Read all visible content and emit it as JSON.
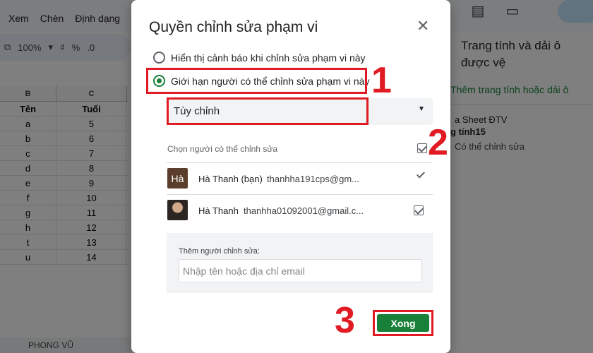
{
  "background": {
    "menu": [
      "Xem",
      "Chèn",
      "Định dạng"
    ],
    "toolbar": {
      "zoom": "100%",
      "currency": "₫",
      "percent": "%",
      "decimal": ".0"
    },
    "columns": [
      "B",
      "C"
    ],
    "table": {
      "headers": [
        "Tên",
        "Tuổi"
      ],
      "rows": [
        [
          "a",
          "5"
        ],
        [
          "b",
          "6"
        ],
        [
          "c",
          "7"
        ],
        [
          "d",
          "8"
        ],
        [
          "e",
          "9"
        ],
        [
          "f",
          "10"
        ],
        [
          "g",
          "11"
        ],
        [
          "h",
          "12"
        ],
        [
          "t",
          "13"
        ],
        [
          "u",
          "14"
        ]
      ]
    },
    "side_panel": {
      "title": "Trang tính và dải ô được vệ",
      "add_link": "Thêm trang tính hoặc dải ô",
      "item_line1": "a Sheet ĐTV",
      "item_line2": "g tính15",
      "item_line3": "Có thể chỉnh sửa"
    },
    "sheet_tab": "PHONG VŨ"
  },
  "dialog": {
    "title": "Quyền chỉnh sửa phạm vi",
    "radio_warning": "Hiển thị cảnh báo khi chỉnh sửa phạm vi này",
    "radio_restrict": "Giới hạn người có thể chỉnh sửa phạm vi này",
    "select_value": "Tùy chỉnh",
    "editors_header": "Chọn người có thể chỉnh sửa",
    "editors": [
      {
        "avatar_text": "Hà",
        "name": "Hà Thanh (bạn)",
        "email": "thanhha191cps@gm..."
      },
      {
        "avatar_text": "",
        "name": "Hà Thanh",
        "email": "thanhha01092001@gmail.c..."
      }
    ],
    "add_label": "Thêm người chỉnh sửa:",
    "add_placeholder": "Nhập tên hoặc địa chỉ email",
    "done_label": "Xong"
  },
  "annotations": {
    "step1": "1",
    "step2": "2",
    "step3": "3"
  },
  "colors": {
    "accent_green": "#188038",
    "annotation_red": "#e01b24"
  }
}
